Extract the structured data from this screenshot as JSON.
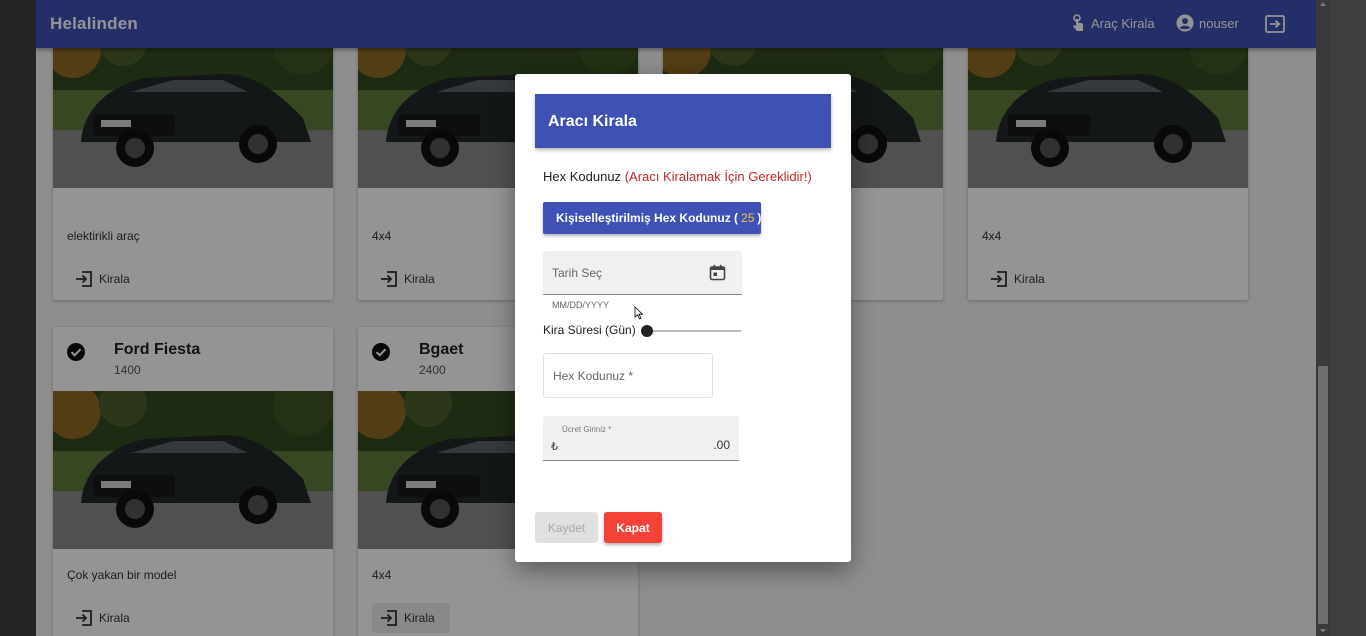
{
  "appbar": {
    "brand": "Helalinden",
    "rent_link": "Araç Kirala",
    "user": "nouser"
  },
  "cards": [
    {
      "desc": "elektirikli araç",
      "action": "Kirala"
    },
    {
      "desc": "4x4",
      "action": "Kirala"
    },
    {
      "desc": "",
      "action": ""
    },
    {
      "desc": "4x4",
      "action": "Kirala"
    },
    {
      "title": "Ford Fiesta",
      "price": "1400",
      "desc": "Çok yakan bir model",
      "action": "Kirala"
    },
    {
      "title": "Bgaet",
      "price": "2400",
      "desc": "4x4",
      "action": "Kirala"
    }
  ],
  "dialog": {
    "title": "Aracı Kirala",
    "hex_note": "Hex Kodunuz",
    "hex_required": "(Aracı Kiralamak İçin Gereklidir!)",
    "hex_button_label": "Kişiselleştirilmiş Hex Kodunuz (",
    "hex_button_number": "25",
    "hex_button_close": ")",
    "date_placeholder": "Tarih Seç",
    "date_hint": "MM/DD/YYYY",
    "slider_label": "Kira Süresi (Gün)",
    "slider_value": 0,
    "hex_input_placeholder": "Hex Kodunuz *",
    "fee_label": "Ücret Giriniz *",
    "fee_currency": "₺",
    "fee_value": ".00",
    "save": "Kaydet",
    "close": "Kapat"
  },
  "colors": {
    "primary": "#3f51b5",
    "danger": "#f44336",
    "required_text": "#c62828",
    "hex_number": "#f4c43d"
  }
}
